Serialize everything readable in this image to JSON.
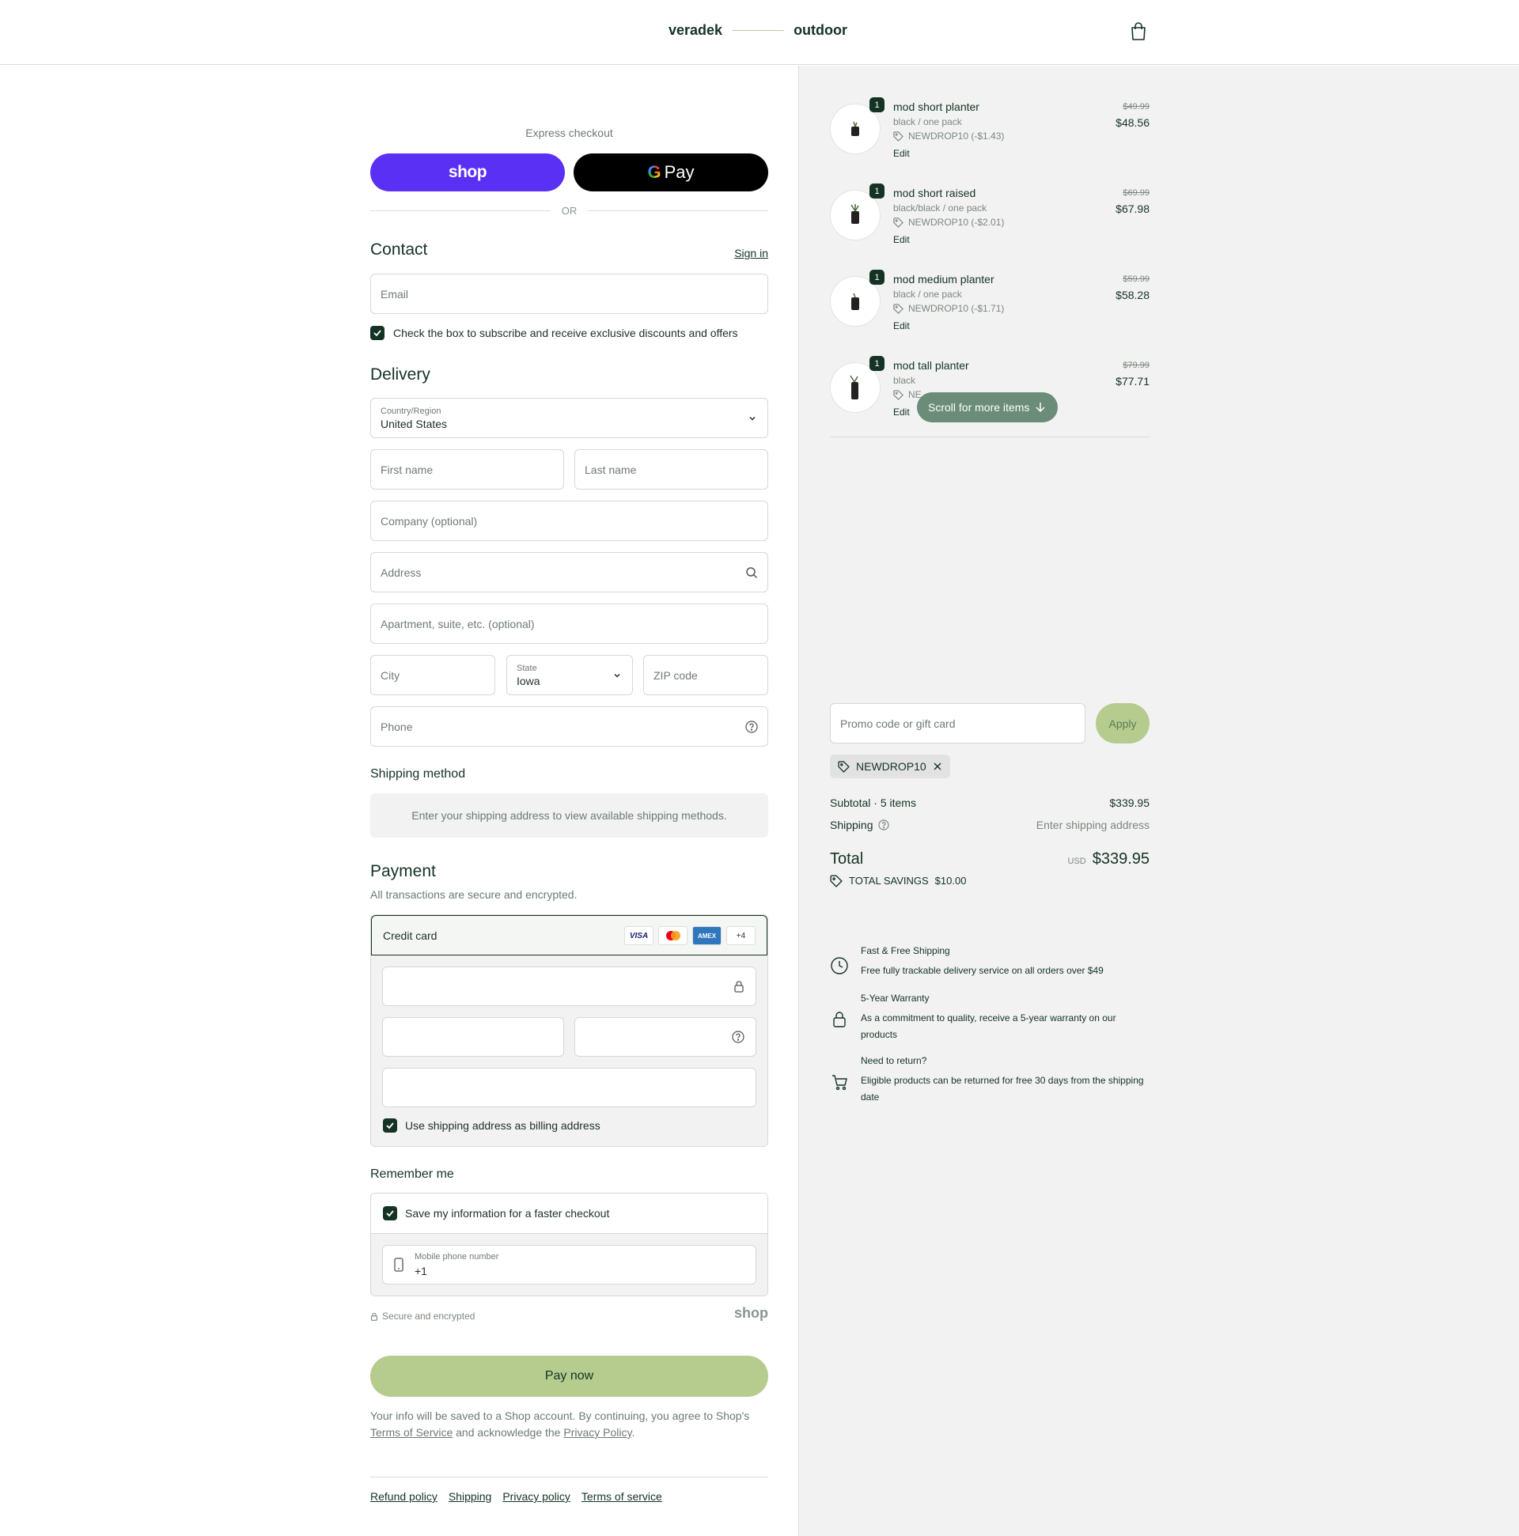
{
  "header": {
    "brand_left": "veradek",
    "brand_right": "outdoor"
  },
  "express": {
    "label": "Express checkout",
    "shop_label": "shop",
    "gpay_g": "G",
    "gpay_label": "Pay",
    "or": "OR"
  },
  "contact": {
    "title": "Contact",
    "sign_in": "Sign in",
    "email_placeholder": "Email",
    "subscribe_label": "Check the box to subscribe and receive exclusive discounts and offers"
  },
  "delivery": {
    "title": "Delivery",
    "country_label": "Country/Region",
    "country_value": "United States",
    "first_name": "First name",
    "last_name": "Last name",
    "company": "Company (optional)",
    "address": "Address",
    "apartment": "Apartment, suite, etc. (optional)",
    "city": "City",
    "state_label": "State",
    "state_value": "Iowa",
    "zip": "ZIP code",
    "phone": "Phone"
  },
  "shipping_method": {
    "title": "Shipping method",
    "note": "Enter your shipping address to view available shipping methods."
  },
  "payment": {
    "title": "Payment",
    "subtitle": "All transactions are secure and encrypted.",
    "method": "Credit card",
    "cards": [
      "VISA",
      "MC",
      "AMEX",
      "+4"
    ],
    "billing_label": "Use shipping address as billing address"
  },
  "remember": {
    "title": "Remember me",
    "save_label": "Save my information for a faster checkout",
    "phone_label": "Mobile phone number",
    "phone_value": "+1",
    "secure": "Secure and encrypted",
    "shop_logo": "shop"
  },
  "pay_now": "Pay now",
  "legal": {
    "line1": "Your info will be saved to a Shop account. By continuing, you agree to Shop's",
    "terms": "Terms of Service",
    "mid": "and acknowledge the",
    "privacy": "Privacy Policy",
    "end": "."
  },
  "footer_links": [
    "Refund policy",
    "Shipping",
    "Privacy policy",
    "Terms of service"
  ],
  "summary": {
    "items": [
      {
        "qty": "1",
        "name": "mod short planter",
        "variant": "black / one pack",
        "discount": "NEWDROP10 (-$1.43)",
        "edit": "Edit",
        "old_price": "$49.99",
        "price": "$48.56"
      },
      {
        "qty": "1",
        "name": "mod short raised",
        "variant": "black/black / one pack",
        "discount": "NEWDROP10 (-$2.01)",
        "edit": "Edit",
        "old_price": "$69.99",
        "price": "$67.98"
      },
      {
        "qty": "1",
        "name": "mod medium planter",
        "variant": "black / one pack",
        "discount": "NEWDROP10 (-$1.71)",
        "edit": "Edit",
        "old_price": "$59.99",
        "price": "$58.28"
      },
      {
        "qty": "1",
        "name": "mod tall planter",
        "variant": "black",
        "discount": "NE",
        "edit": "Edit",
        "old_price": "$79.99",
        "price": "$77.71"
      }
    ],
    "scroll_hint": "Scroll for more items",
    "promo_placeholder": "Promo code or gift card",
    "apply": "Apply",
    "applied_code": "NEWDROP10",
    "subtotal_label": "Subtotal · 5 items",
    "subtotal_value": "$339.95",
    "shipping_label": "Shipping",
    "shipping_value": "Enter shipping address",
    "total_label": "Total",
    "currency": "USD",
    "total_value": "$339.95",
    "savings_label": "TOTAL SAVINGS",
    "savings_value": "$10.00"
  },
  "perks": [
    {
      "title": "Fast & Free Shipping",
      "text": "Free fully trackable delivery service on all orders over $49"
    },
    {
      "title": "5-Year Warranty",
      "text": "As a commitment to quality, receive a 5-year warranty on our products"
    },
    {
      "title": "Need to return?",
      "text": "Eligible products can be returned for free 30 days from the shipping date"
    }
  ],
  "colors": {
    "accent": "#143324",
    "shop_purple": "#5a31f4",
    "pay_green": "#b5cc8e",
    "pill": "#6a8c78"
  }
}
